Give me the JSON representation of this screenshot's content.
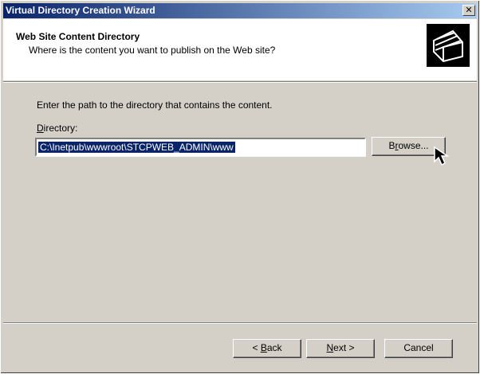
{
  "window": {
    "title": "Virtual Directory Creation Wizard",
    "close_icon": "close-icon"
  },
  "header": {
    "title": "Web Site Content Directory",
    "subtitle": "Where is the content you want to publish on the Web site?",
    "icon": "folders-icon"
  },
  "body": {
    "instruction": "Enter the path to the directory that contains the content.",
    "directory_label": "Directory:",
    "directory_value": "C:\\Inetpub\\wwwroot\\STCPWEB_ADMIN\\www",
    "browse_label": "Browse..."
  },
  "footer": {
    "back_label": "< Back",
    "next_label": "Next >",
    "cancel_label": "Cancel"
  }
}
